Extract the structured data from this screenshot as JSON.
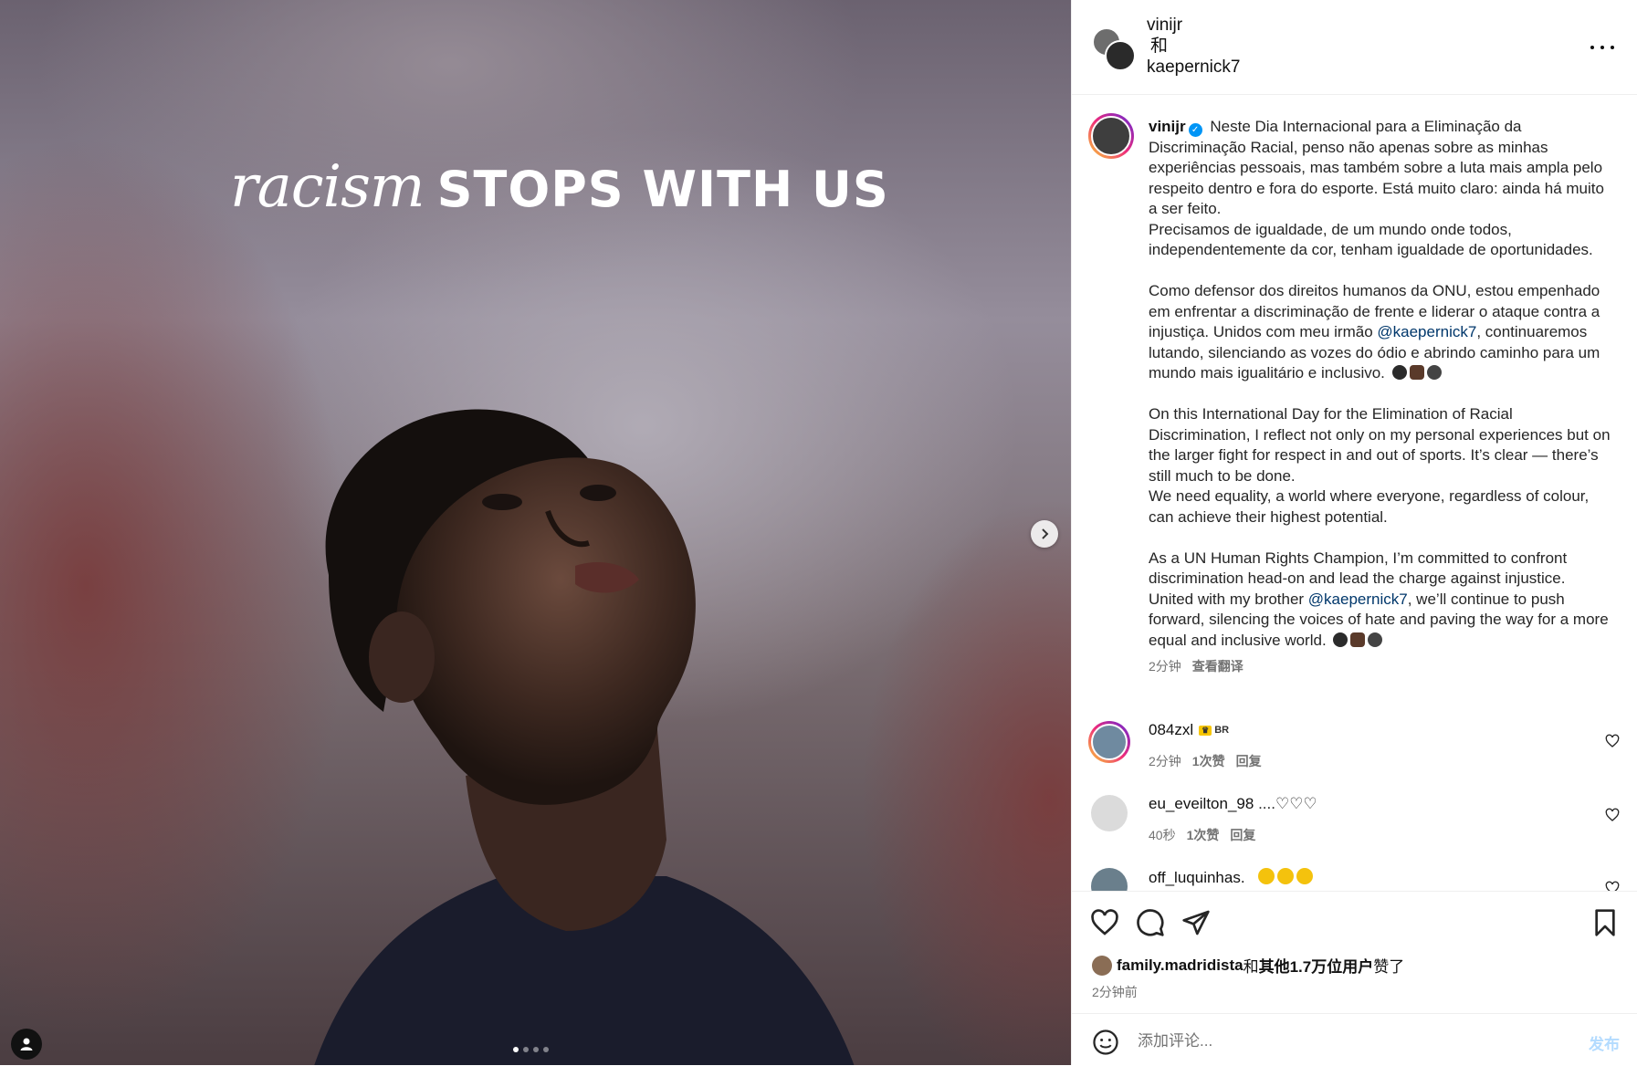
{
  "media": {
    "headline_italic": "racism",
    "headline_caps": "STOPS WITH US",
    "carousel_count": 4,
    "carousel_active": 1
  },
  "header": {
    "user1": "vinijr",
    "and": "和",
    "user2": "kaepernick7"
  },
  "caption": {
    "username": "vinijr",
    "pt_p1": "Neste Dia Internacional para a Eliminação da Discriminação Racial, penso não apenas sobre as minhas experiências pessoais, mas também sobre a luta mais ampla pelo respeito dentro e fora do esporte. Está muito claro: ainda há muito a ser feito.",
    "pt_p2": "Precisamos de igualdade, de um mundo onde todos, independentemente da cor, tenham igualdade de oportunidades.",
    "pt_p3_before": "Como defensor dos direitos humanos da ONU, estou empenhado em enfrentar a discriminação de frente e liderar o ataque contra a injustiça. Unidos com meu irmão ",
    "pt_p3_mention": "@kaepernick7",
    "pt_p3_after": ", continuaremos lutando, silenciando as vozes do ódio e abrindo caminho para um mundo mais igualitário e inclusivo.",
    "en_p1": "On this International Day for the Elimination of Racial Discrimination, I reflect not only on my personal experiences but on the larger fight for respect in and out of sports. It’s clear — there’s still much to be done.",
    "en_p2": "We need equality, a world where everyone, regardless of colour, can achieve their highest potential.",
    "en_p3_before": "As a UN Human Rights Champion, I’m committed to confront discrimination head-on and lead the charge against injustice. United with my brother ",
    "en_p3_mention": "@kaepernick7",
    "en_p3_after": ", we’ll continue to push forward, silencing the voices of hate and paving the way for a more equal and inclusive world.",
    "time": "2分钟",
    "translate": "查看翻译"
  },
  "comments": [
    {
      "username": "084zxl",
      "badge": "BR",
      "time": "2分钟",
      "likes": "1次赞",
      "reply": "回复"
    },
    {
      "username": "eu_eveilton_98",
      "text": "....♡♡♡",
      "time": "40秒",
      "likes": "1次赞",
      "reply": "回复"
    },
    {
      "username": "off_luquinhas.",
      "text": ""
    }
  ],
  "likes": {
    "user": "family.madridista",
    "and": "和",
    "others": "其他1.7万位用户",
    "suffix": "赞了",
    "time": "2分钟前"
  },
  "comment_box": {
    "placeholder": "添加评论...",
    "post": "发布"
  },
  "colors": {
    "link": "#00376b",
    "verified": "#0095f6",
    "post_disabled": "#b3dbff"
  }
}
